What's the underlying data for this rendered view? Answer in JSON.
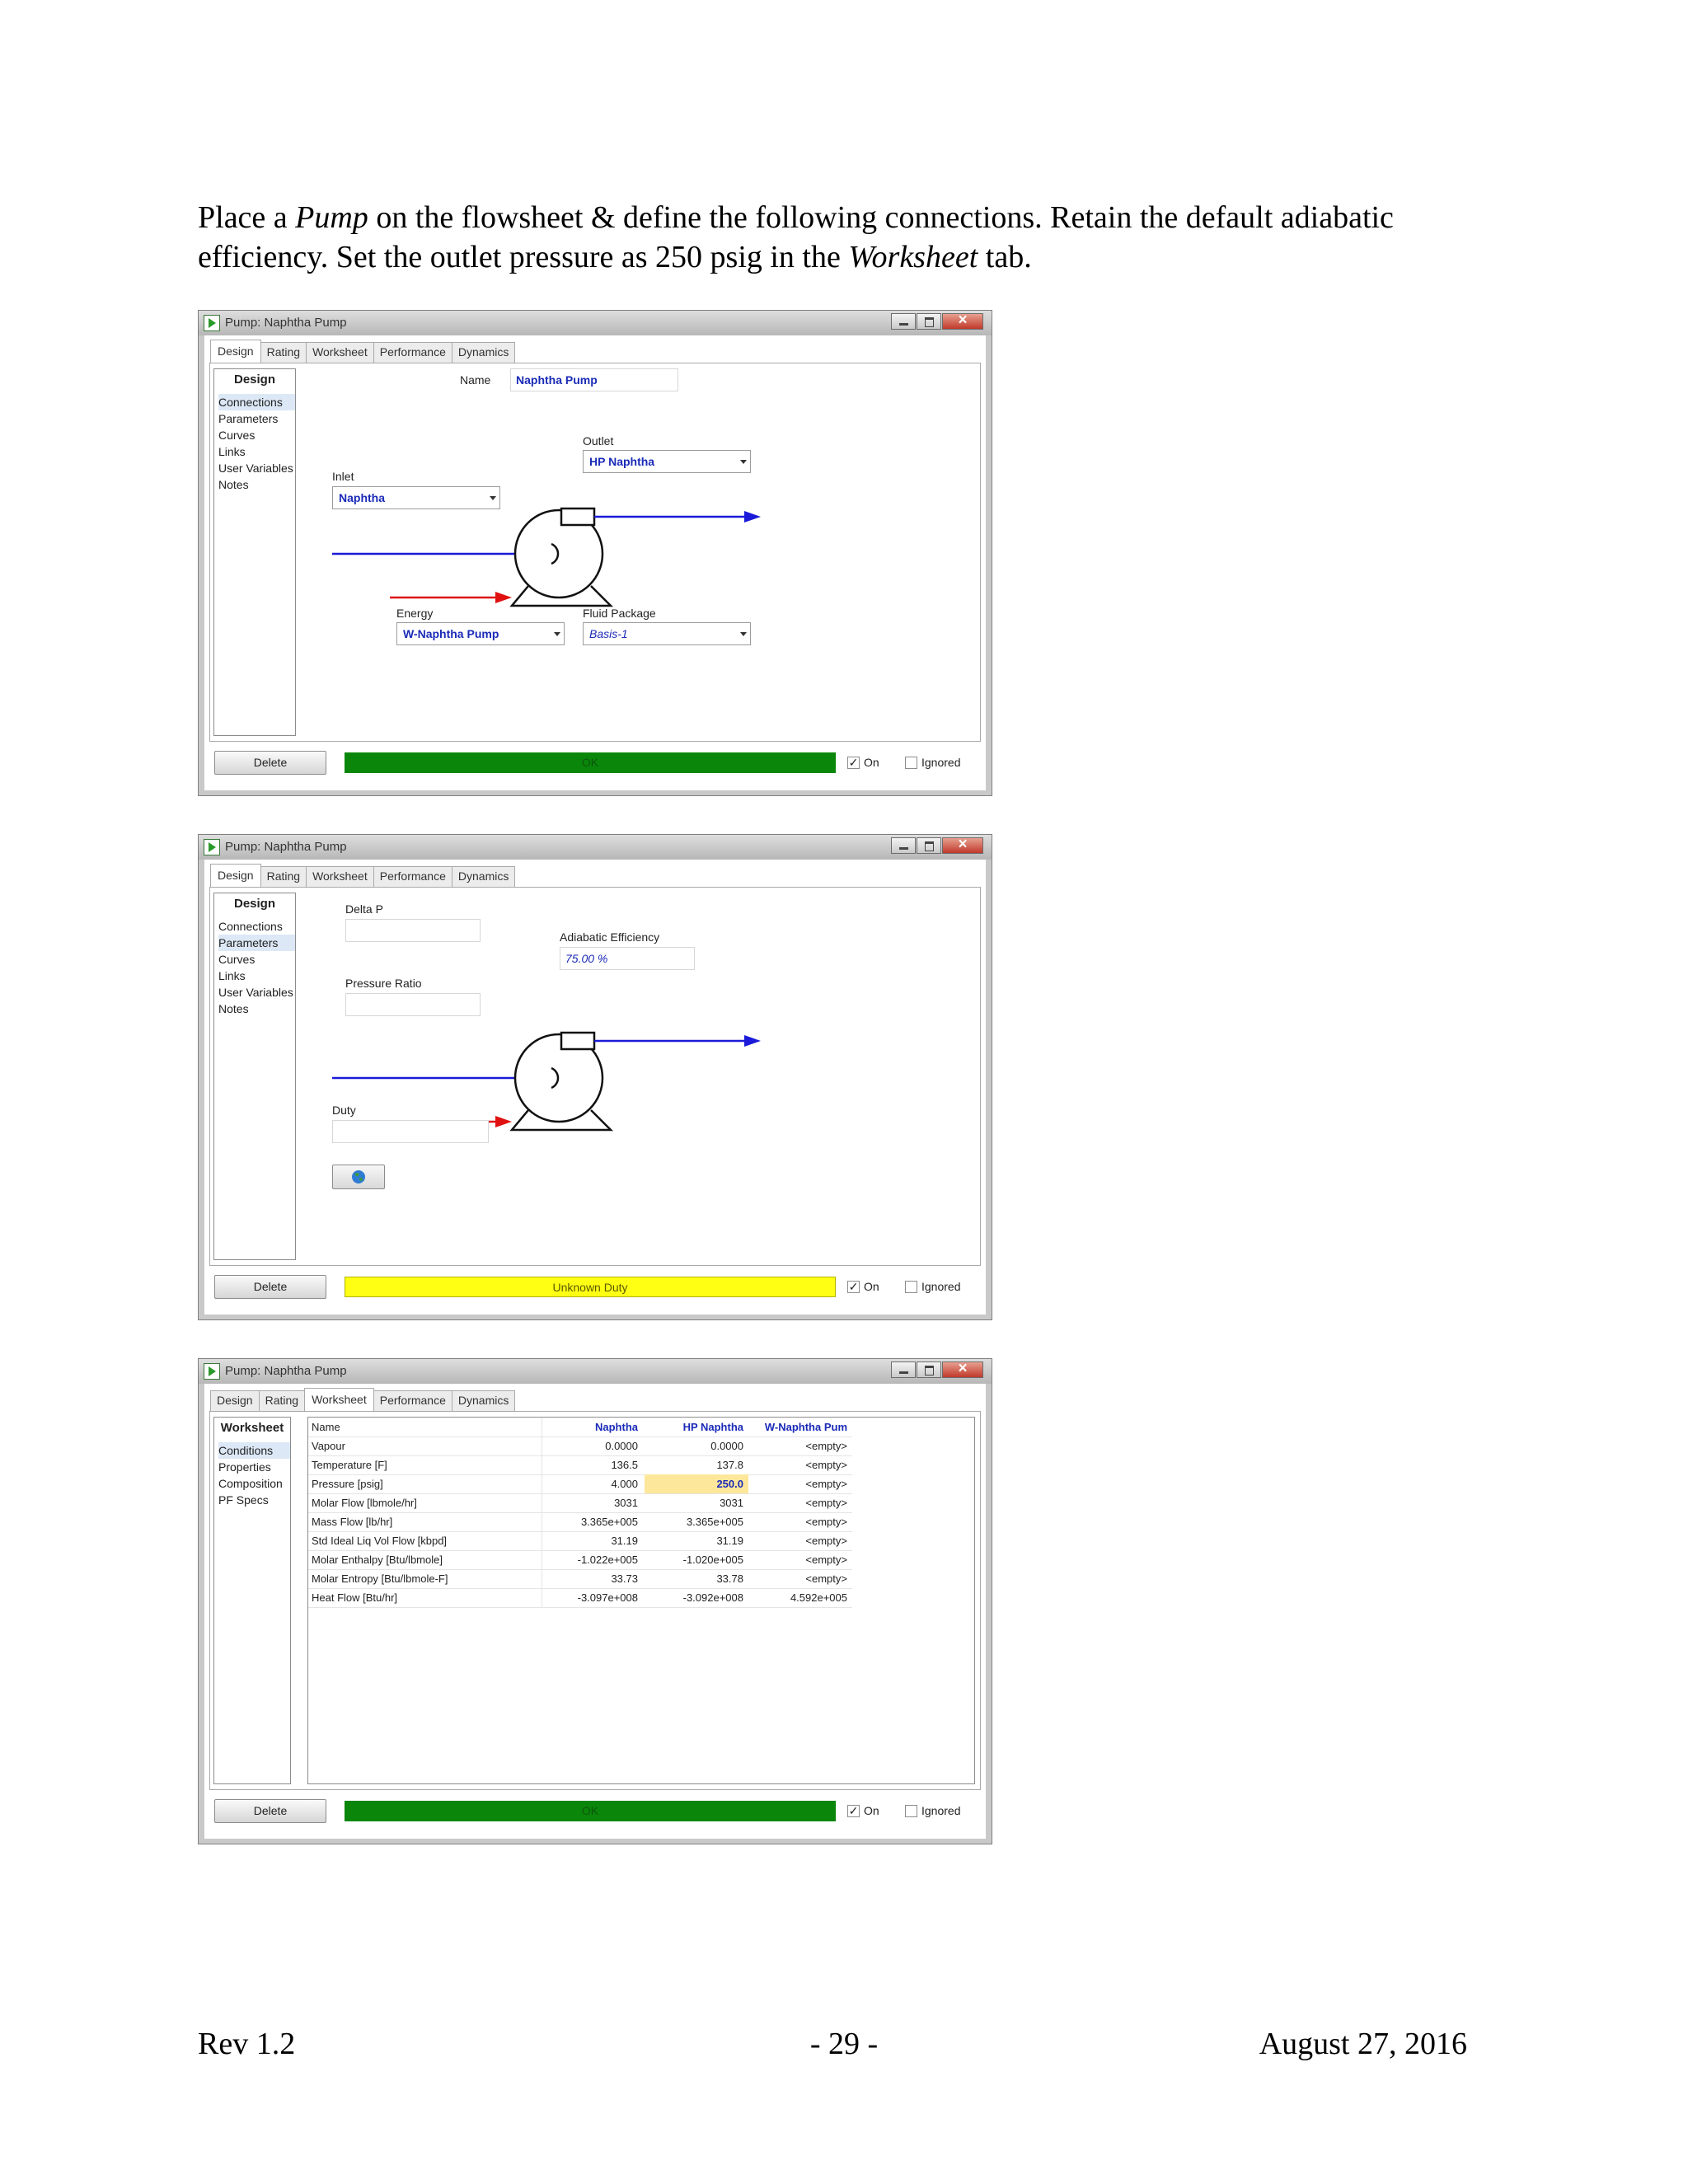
{
  "instructions": {
    "p1": "Place a",
    "pump_word": "Pump",
    "p2": "on the flowsheet & define the following connections. Retain the default adiabatic efficiency. Set the outlet pressure as 250 psig in the",
    "worksheet_word": "Worksheet",
    "p3": "tab."
  },
  "footer": {
    "rev": "Rev 1.2",
    "page": "- 29 -",
    "date": "August 27, 2016"
  },
  "window_title": "Pump: Naphtha Pump",
  "tabs": [
    "Design",
    "Rating",
    "Worksheet",
    "Performance",
    "Dynamics"
  ],
  "common": {
    "delete_label": "Delete",
    "on_label": "On",
    "ignored_label": "Ignored",
    "on_checked": "✓"
  },
  "colors": {
    "ok": "#0a860a",
    "warning": "#ffff14",
    "stream_blue": "#1a1ad8",
    "energy_red": "#e01010",
    "value_blue": "#1a2ab8"
  },
  "win1": {
    "nav_header": "Design",
    "nav": [
      "Connections",
      "Parameters",
      "Curves",
      "Links",
      "User Variables",
      "Notes"
    ],
    "name_label": "Name",
    "name_value": "Naphtha Pump",
    "inlet_label": "Inlet",
    "inlet_value": "Naphtha",
    "outlet_label": "Outlet",
    "outlet_value": "HP Naphtha",
    "energy_label": "Energy",
    "energy_value": "W-Naphtha Pump",
    "fluid_label": "Fluid Package",
    "fluid_value": "Basis-1",
    "status": "OK"
  },
  "win2": {
    "nav_header": "Design",
    "nav": [
      "Connections",
      "Parameters",
      "Curves",
      "Links",
      "User Variables",
      "Notes"
    ],
    "deltap_label": "Delta P",
    "pratio_label": "Pressure Ratio",
    "eff_label": "Adiabatic Efficiency",
    "eff_value": "75.00 %",
    "duty_label": "Duty",
    "status": "Unknown Duty"
  },
  "win3": {
    "nav_header": "Worksheet",
    "nav": [
      "Conditions",
      "Properties",
      "Composition",
      "PF Specs"
    ],
    "columns": [
      "Name",
      "Naphtha",
      "HP Naphtha",
      "W-Naphtha Pum"
    ],
    "rows": [
      [
        "Vapour",
        "0.0000",
        "0.0000",
        "<empty>"
      ],
      [
        "Temperature [F]",
        "136.5",
        "137.8",
        "<empty>"
      ],
      [
        "Pressure [psig]",
        "4.000",
        "250.0",
        "<empty>"
      ],
      [
        "Molar Flow [lbmole/hr]",
        "3031",
        "3031",
        "<empty>"
      ],
      [
        "Mass Flow [lb/hr]",
        "3.365e+005",
        "3.365e+005",
        "<empty>"
      ],
      [
        "Std Ideal Liq Vol Flow [kbpd]",
        "31.19",
        "31.19",
        "<empty>"
      ],
      [
        "Molar Enthalpy [Btu/lbmole]",
        "-1.022e+005",
        "-1.020e+005",
        "<empty>"
      ],
      [
        "Molar Entropy [Btu/lbmole-F]",
        "33.73",
        "33.78",
        "<empty>"
      ],
      [
        "Heat Flow [Btu/hr]",
        "-3.097e+008",
        "-3.092e+008",
        "4.592e+005"
      ]
    ],
    "status": "OK"
  }
}
